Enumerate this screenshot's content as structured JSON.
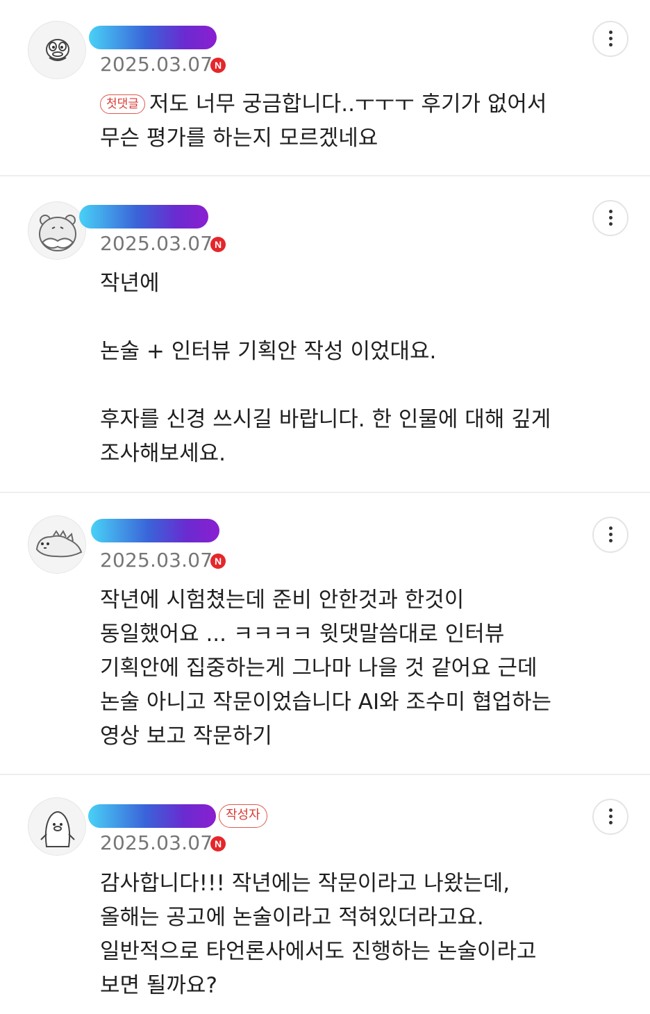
{
  "comments": [
    {
      "avatar_icon": "duck-face-icon",
      "date": "2025.03.07",
      "new_badge": "N",
      "tag": "첫댓글",
      "text": "저도 너무 궁금합니다..ㅜㅜㅜ 후기가 없어서\n무슨 평가를 하는지 모르겠네요",
      "more_icon": "more-vertical-icon"
    },
    {
      "avatar_icon": "bear-face-icon",
      "date": "2025.03.07",
      "new_badge": "N",
      "text": "작년에\n\n논술 + 인터뷰 기획안 작성 이었대요.\n\n후자를 신경 쓰시길 바랍니다. 한 인물에 대해 깊게\n조사해보세요.",
      "more_icon": "more-vertical-icon"
    },
    {
      "avatar_icon": "dinosaur-icon",
      "date": "2025.03.07",
      "new_badge": "N",
      "text": "작년에 시험쳤는데 준비 안한것과 한것이\n동일했어요 ... ㅋㅋㅋㅋ 윗댓말씀대로 인터뷰\n기획안에 집중하는게 그나마 나을 것 같어요 근데\n논술 아니고 작문이었습니다 AI와 조수미 협업하는\n영상 보고 작문하기",
      "more_icon": "more-vertical-icon"
    },
    {
      "avatar_icon": "penguin-icon",
      "date": "2025.03.07",
      "new_badge": "N",
      "author_tag": "작성자",
      "text": "감사합니다!!! 작년에는 작문이라고 나왔는데,\n올해는 공고에 논술이라고 적혀있더라고요.\n일반적으로 타언론사에서도 진행하는 논술이라고\n보면 될까요?",
      "more_icon": "more-vertical-icon"
    }
  ],
  "colors": {
    "name_gradient": [
      "#49d1f6",
      "#3a63d8",
      "#8a1fd0"
    ],
    "new_badge": "#e5262a",
    "tag_red": "#d93b35",
    "date_gray": "#767676"
  }
}
